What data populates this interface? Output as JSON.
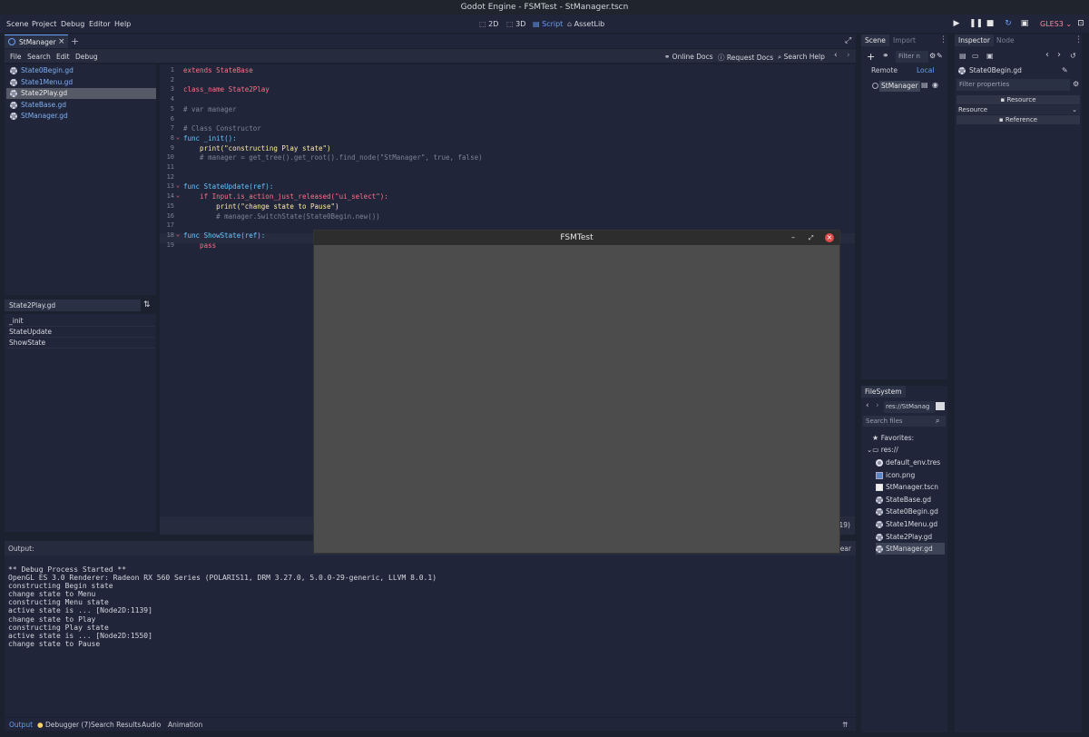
{
  "window_title": "Godot Engine - FSMTest - StManager.tscn",
  "menu": [
    "Scene",
    "Project",
    "Debug",
    "Editor",
    "Help"
  ],
  "workspaces": [
    "2D",
    "3D",
    "Script",
    "AssetLib"
  ],
  "renderer": "GLES3",
  "colors": {
    "accent": "#6a9ff5",
    "keyword": "#ff7085",
    "function": "#66c5ff",
    "string": "#ffeda1",
    "comment": "#7d8392",
    "close": "#e04a4a"
  },
  "scene_tab": {
    "label": "StManager",
    "close": "×",
    "add": "+"
  },
  "script_menu": [
    "File",
    "Search",
    "Edit",
    "Debug"
  ],
  "script_toolbar": {
    "online_docs": "Online Docs",
    "request_docs": "Request Docs",
    "search_help": "Search Help"
  },
  "files": [
    "State0Begin.gd",
    "State1Menu.gd",
    "State2Play.gd",
    "StateBase.gd",
    "StManager.gd"
  ],
  "selected_file": "State2Play.gd",
  "methods_title": "State2Play.gd",
  "methods": [
    "_init",
    "StateUpdate",
    "ShowState"
  ],
  "code_lines": [
    {
      "n": "1",
      "t": "extends StateBase",
      "c": "kw"
    },
    {
      "n": "2",
      "t": "",
      "c": ""
    },
    {
      "n": "3",
      "t": "class_name State2Play",
      "c": "kw"
    },
    {
      "n": "4",
      "t": "",
      "c": ""
    },
    {
      "n": "5",
      "t": "# var manager",
      "c": "cm"
    },
    {
      "n": "6",
      "t": "",
      "c": ""
    },
    {
      "n": "7",
      "t": "# Class Constructor",
      "c": "cm"
    },
    {
      "n": "8",
      "t": "func _init():",
      "c": "fn"
    },
    {
      "n": "9",
      "t": "    print(\"constructing Play state\")",
      "c": "str"
    },
    {
      "n": "10",
      "t": "    # manager = get_tree().get_root().find_node(\"StManager\", true, false)",
      "c": "cm"
    },
    {
      "n": "11",
      "t": "",
      "c": ""
    },
    {
      "n": "12",
      "t": "",
      "c": ""
    },
    {
      "n": "13",
      "t": "func StateUpdate(ref):",
      "c": "fn"
    },
    {
      "n": "14",
      "t": "    if Input.is_action_just_released(\"ui_select\"):",
      "c": "kw"
    },
    {
      "n": "15",
      "t": "        print(\"change state to Pause\")",
      "c": "str"
    },
    {
      "n": "16",
      "t": "        # manager.SwitchState(State0Begin.new())",
      "c": "cm"
    },
    {
      "n": "17",
      "t": "",
      "c": ""
    },
    {
      "n": "18",
      "t": "func ShowState(ref):",
      "c": "fn"
    },
    {
      "n": "19",
      "t": "    pass",
      "c": "kw"
    }
  ],
  "editor_status_frag": "19)",
  "output_title": "Output:",
  "clear_frag": "lear",
  "output_lines": [
    "** Debug Process Started **",
    "OpenGL ES 3.0 Renderer: Radeon RX 560 Series (POLARIS11, DRM 3.27.0, 5.0.0-29-generic, LLVM 8.0.1)",
    "constructing Begin state",
    "change state to Menu",
    "constructing Menu state",
    "active state is ... [Node2D:1139]",
    "change state to Play",
    "constructing Play state",
    "active state is ... [Node2D:1550]",
    "change state to Pause"
  ],
  "bottom_tabs": [
    "Output",
    "Debugger (7)",
    "Search Results",
    "Audio",
    "Animation"
  ],
  "game_window": {
    "title": "FSMTest",
    "minimize": "–",
    "restore": "⤢",
    "close": "×"
  },
  "scene_panel": {
    "tabs": [
      "Scene",
      "Import"
    ],
    "filter": "Filter n",
    "remote": "Remote",
    "local": "Local",
    "node": "StManager"
  },
  "filesystem": {
    "tab": "FileSystem",
    "path": "res://StManag",
    "search": "Search files",
    "favorites": "Favorites:",
    "root": "res://",
    "items": [
      "default_env.tres",
      "icon.png",
      "StManager.tscn",
      "StateBase.gd",
      "State0Begin.gd",
      "State1Menu.gd",
      "State2Play.gd",
      "StManager.gd"
    ]
  },
  "inspector": {
    "tabs": [
      "Inspector",
      "Node"
    ],
    "object": "State0Begin.gd",
    "filter": "Filter properties",
    "resource_btn": "Resource",
    "section": "Resource",
    "reference_btn": "Reference"
  }
}
